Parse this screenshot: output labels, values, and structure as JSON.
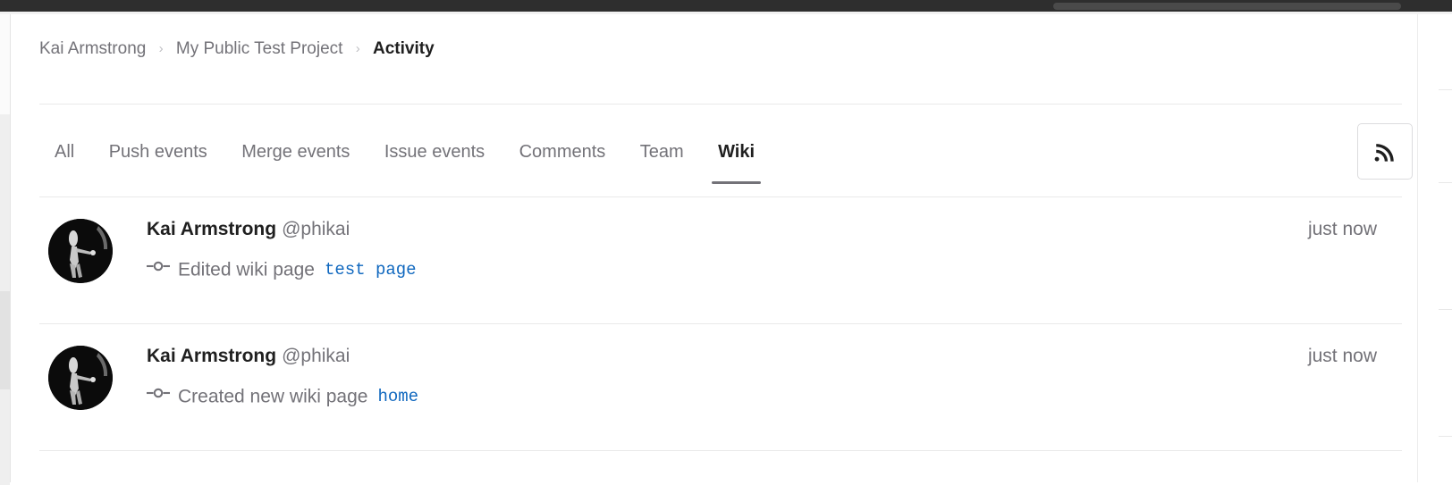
{
  "breadcrumb": {
    "items": [
      {
        "label": "Kai Armstrong",
        "current": false
      },
      {
        "label": "My Public Test Project",
        "current": false
      },
      {
        "label": "Activity",
        "current": true
      }
    ],
    "separator": "›"
  },
  "tabs": [
    {
      "label": "All",
      "active": false
    },
    {
      "label": "Push events",
      "active": false
    },
    {
      "label": "Merge events",
      "active": false
    },
    {
      "label": "Issue events",
      "active": false
    },
    {
      "label": "Comments",
      "active": false
    },
    {
      "label": "Team",
      "active": false
    },
    {
      "label": "Wiki",
      "active": true
    }
  ],
  "feed_button": {
    "icon": "rss-icon",
    "title": "Subscribe to RSS feed"
  },
  "events": [
    {
      "author": "Kai Armstrong",
      "handle": "@phikai",
      "icon": "commit-icon",
      "action": "Edited wiki page",
      "target": "test page",
      "timestamp": "just now"
    },
    {
      "author": "Kai Armstrong",
      "handle": "@phikai",
      "icon": "commit-icon",
      "action": "Created new wiki page",
      "target": "home",
      "timestamp": "just now"
    }
  ],
  "colors": {
    "link": "#1068bf",
    "muted": "#737278",
    "text": "#1f1f1f",
    "border": "#e9e9e9",
    "chrome": "#2e2e2e"
  }
}
